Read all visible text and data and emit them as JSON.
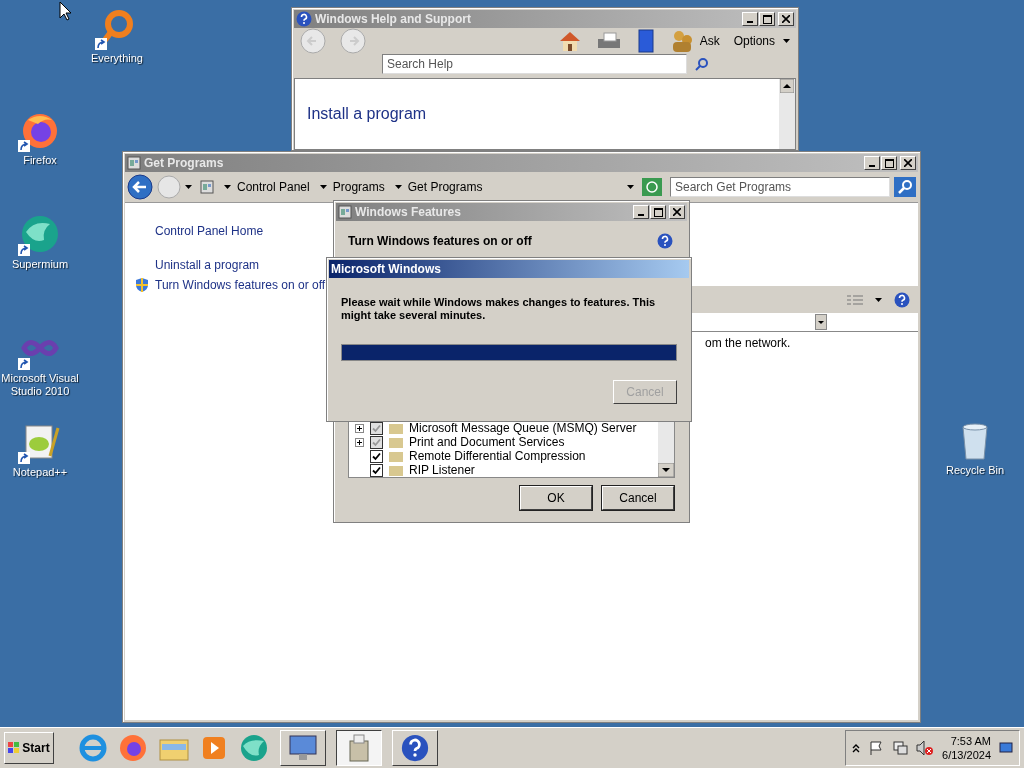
{
  "desktop_icons": [
    {
      "label": "Everything",
      "kind": "everything"
    },
    {
      "label": "Firefox",
      "kind": "firefox"
    },
    {
      "label": "Supermium",
      "kind": "supermium"
    },
    {
      "label": "Microsoft Visual Studio 2010",
      "kind": "vs"
    },
    {
      "label": "Notepad++",
      "kind": "notepad"
    },
    {
      "label": "Recycle Bin",
      "kind": "recycle"
    }
  ],
  "help_window": {
    "title": "Windows Help and Support",
    "ask": "Ask",
    "options": "Options",
    "search": {
      "placeholder": "Search Help"
    },
    "heading": "Install a program"
  },
  "programs_window": {
    "title": "Get Programs",
    "breadcrumb": [
      "Control Panel",
      "Programs",
      "Get Programs"
    ],
    "search": {
      "placeholder": "Search Get Programs"
    },
    "sidebar": {
      "items": [
        {
          "label": "Control Panel Home",
          "shield": false
        },
        {
          "label": "Uninstall a program",
          "shield": false
        },
        {
          "label": "Turn Windows features on or off",
          "shield": true
        }
      ]
    },
    "content_text": "om the network."
  },
  "features_dialog": {
    "title": "Windows Features",
    "heading": "Turn Windows features on or off",
    "features": [
      {
        "label": "Microsoft Message Queue (MSMQ) Server",
        "expandable": true,
        "checked": true,
        "partial": true
      },
      {
        "label": "Print and Document Services",
        "expandable": true,
        "checked": true,
        "partial": true
      },
      {
        "label": "Remote Differential Compression",
        "expandable": false,
        "checked": true,
        "partial": false
      },
      {
        "label": "RIP Listener",
        "expandable": false,
        "checked": true,
        "partial": false
      }
    ],
    "buttons": [
      "OK",
      "Cancel"
    ]
  },
  "progress_dialog": {
    "title": "Microsoft Windows",
    "message": "Please wait while Windows makes changes to features. This might take several minutes.",
    "level": 1,
    "cancel": {
      "label": "Cancel",
      "disabled": true
    }
  },
  "taskbar": {
    "start": "Start",
    "windows": [
      {
        "selected": false
      },
      {
        "selected": true
      },
      {
        "selected": false
      }
    ],
    "clock": {
      "time": "7:53 AM",
      "date": "6/13/2024"
    }
  }
}
